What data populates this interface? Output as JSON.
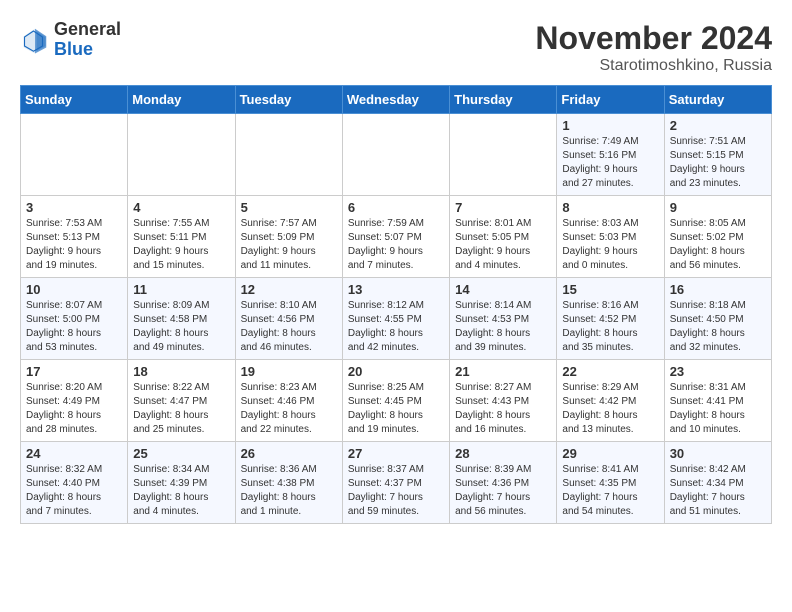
{
  "logo": {
    "general": "General",
    "blue": "Blue"
  },
  "title": "November 2024",
  "location": "Starotimoshkino, Russia",
  "days_header": [
    "Sunday",
    "Monday",
    "Tuesday",
    "Wednesday",
    "Thursday",
    "Friday",
    "Saturday"
  ],
  "weeks": [
    [
      {
        "day": "",
        "info": ""
      },
      {
        "day": "",
        "info": ""
      },
      {
        "day": "",
        "info": ""
      },
      {
        "day": "",
        "info": ""
      },
      {
        "day": "",
        "info": ""
      },
      {
        "day": "1",
        "info": "Sunrise: 7:49 AM\nSunset: 5:16 PM\nDaylight: 9 hours\nand 27 minutes."
      },
      {
        "day": "2",
        "info": "Sunrise: 7:51 AM\nSunset: 5:15 PM\nDaylight: 9 hours\nand 23 minutes."
      }
    ],
    [
      {
        "day": "3",
        "info": "Sunrise: 7:53 AM\nSunset: 5:13 PM\nDaylight: 9 hours\nand 19 minutes."
      },
      {
        "day": "4",
        "info": "Sunrise: 7:55 AM\nSunset: 5:11 PM\nDaylight: 9 hours\nand 15 minutes."
      },
      {
        "day": "5",
        "info": "Sunrise: 7:57 AM\nSunset: 5:09 PM\nDaylight: 9 hours\nand 11 minutes."
      },
      {
        "day": "6",
        "info": "Sunrise: 7:59 AM\nSunset: 5:07 PM\nDaylight: 9 hours\nand 7 minutes."
      },
      {
        "day": "7",
        "info": "Sunrise: 8:01 AM\nSunset: 5:05 PM\nDaylight: 9 hours\nand 4 minutes."
      },
      {
        "day": "8",
        "info": "Sunrise: 8:03 AM\nSunset: 5:03 PM\nDaylight: 9 hours\nand 0 minutes."
      },
      {
        "day": "9",
        "info": "Sunrise: 8:05 AM\nSunset: 5:02 PM\nDaylight: 8 hours\nand 56 minutes."
      }
    ],
    [
      {
        "day": "10",
        "info": "Sunrise: 8:07 AM\nSunset: 5:00 PM\nDaylight: 8 hours\nand 53 minutes."
      },
      {
        "day": "11",
        "info": "Sunrise: 8:09 AM\nSunset: 4:58 PM\nDaylight: 8 hours\nand 49 minutes."
      },
      {
        "day": "12",
        "info": "Sunrise: 8:10 AM\nSunset: 4:56 PM\nDaylight: 8 hours\nand 46 minutes."
      },
      {
        "day": "13",
        "info": "Sunrise: 8:12 AM\nSunset: 4:55 PM\nDaylight: 8 hours\nand 42 minutes."
      },
      {
        "day": "14",
        "info": "Sunrise: 8:14 AM\nSunset: 4:53 PM\nDaylight: 8 hours\nand 39 minutes."
      },
      {
        "day": "15",
        "info": "Sunrise: 8:16 AM\nSunset: 4:52 PM\nDaylight: 8 hours\nand 35 minutes."
      },
      {
        "day": "16",
        "info": "Sunrise: 8:18 AM\nSunset: 4:50 PM\nDaylight: 8 hours\nand 32 minutes."
      }
    ],
    [
      {
        "day": "17",
        "info": "Sunrise: 8:20 AM\nSunset: 4:49 PM\nDaylight: 8 hours\nand 28 minutes."
      },
      {
        "day": "18",
        "info": "Sunrise: 8:22 AM\nSunset: 4:47 PM\nDaylight: 8 hours\nand 25 minutes."
      },
      {
        "day": "19",
        "info": "Sunrise: 8:23 AM\nSunset: 4:46 PM\nDaylight: 8 hours\nand 22 minutes."
      },
      {
        "day": "20",
        "info": "Sunrise: 8:25 AM\nSunset: 4:45 PM\nDaylight: 8 hours\nand 19 minutes."
      },
      {
        "day": "21",
        "info": "Sunrise: 8:27 AM\nSunset: 4:43 PM\nDaylight: 8 hours\nand 16 minutes."
      },
      {
        "day": "22",
        "info": "Sunrise: 8:29 AM\nSunset: 4:42 PM\nDaylight: 8 hours\nand 13 minutes."
      },
      {
        "day": "23",
        "info": "Sunrise: 8:31 AM\nSunset: 4:41 PM\nDaylight: 8 hours\nand 10 minutes."
      }
    ],
    [
      {
        "day": "24",
        "info": "Sunrise: 8:32 AM\nSunset: 4:40 PM\nDaylight: 8 hours\nand 7 minutes."
      },
      {
        "day": "25",
        "info": "Sunrise: 8:34 AM\nSunset: 4:39 PM\nDaylight: 8 hours\nand 4 minutes."
      },
      {
        "day": "26",
        "info": "Sunrise: 8:36 AM\nSunset: 4:38 PM\nDaylight: 8 hours\nand 1 minute."
      },
      {
        "day": "27",
        "info": "Sunrise: 8:37 AM\nSunset: 4:37 PM\nDaylight: 7 hours\nand 59 minutes."
      },
      {
        "day": "28",
        "info": "Sunrise: 8:39 AM\nSunset: 4:36 PM\nDaylight: 7 hours\nand 56 minutes."
      },
      {
        "day": "29",
        "info": "Sunrise: 8:41 AM\nSunset: 4:35 PM\nDaylight: 7 hours\nand 54 minutes."
      },
      {
        "day": "30",
        "info": "Sunrise: 8:42 AM\nSunset: 4:34 PM\nDaylight: 7 hours\nand 51 minutes."
      }
    ]
  ]
}
